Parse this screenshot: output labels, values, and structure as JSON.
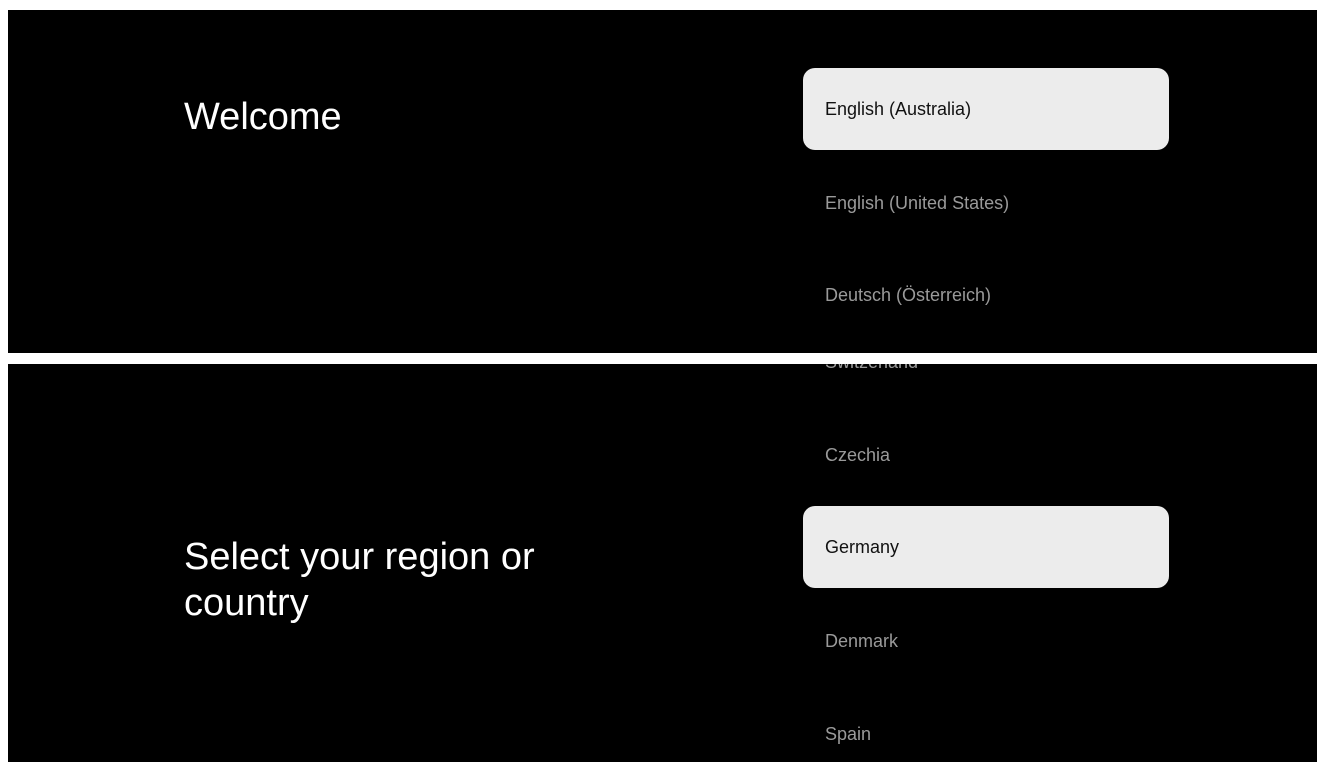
{
  "language_screen": {
    "title": "Welcome",
    "options": [
      {
        "label": "English (Australia)",
        "selected": true
      },
      {
        "label": "English (United States)",
        "selected": false
      },
      {
        "label": "Deutsch (Österreich)",
        "selected": false
      }
    ]
  },
  "region_screen": {
    "title": "Select your region or country",
    "options": [
      {
        "label": "Switzerland",
        "selected": false
      },
      {
        "label": "Czechia",
        "selected": false
      },
      {
        "label": "Germany",
        "selected": true
      },
      {
        "label": "Denmark",
        "selected": false
      },
      {
        "label": "Spain",
        "selected": false
      }
    ]
  },
  "colors": {
    "background": "#000000",
    "selected_background": "#ececec",
    "selected_text": "#111111",
    "unselected_text": "#9a9a9a",
    "title_text": "#ffffff"
  }
}
